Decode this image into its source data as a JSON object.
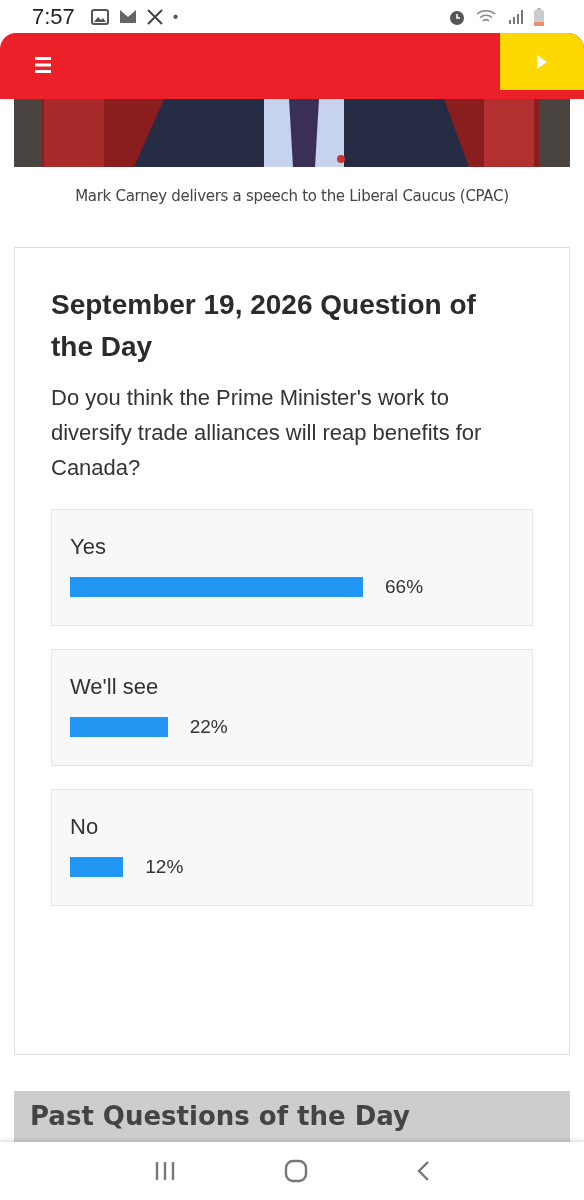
{
  "status_bar": {
    "time": "7:57",
    "dot": "•"
  },
  "photo": {
    "kind": "picture",
    "caption": "Mark Carney delivers a speech to the Liberal Caucus (CPAC)"
  },
  "poll": {
    "title": "September 19, 2026 Question of the Day",
    "question": "Do you think the Prime Minister's work to diversify trade alliances will reap benefits for Canada?",
    "options": [
      {
        "label": "Yes",
        "percent": "66%"
      },
      {
        "label": "We'll see",
        "percent": "22%"
      },
      {
        "label": "No",
        "percent": "12%"
      }
    ]
  },
  "past": {
    "title": "Past Questions of the Day"
  }
}
